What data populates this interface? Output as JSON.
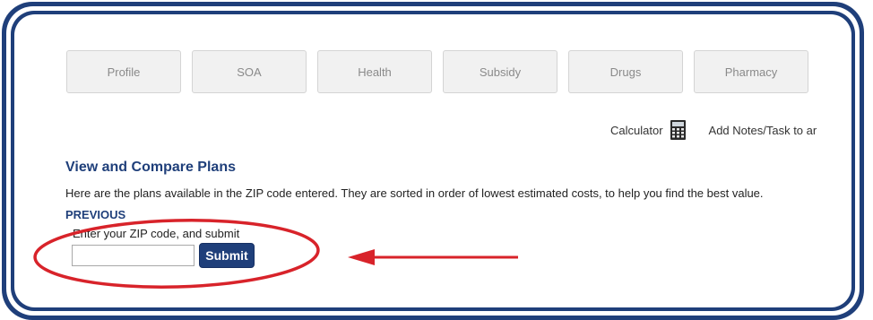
{
  "tabs": [
    {
      "label": "Profile"
    },
    {
      "label": "SOA"
    },
    {
      "label": "Health"
    },
    {
      "label": "Subsidy"
    },
    {
      "label": "Drugs"
    },
    {
      "label": "Pharmacy"
    }
  ],
  "tools": {
    "calculator_label": "Calculator",
    "calculator_icon": "calculator-icon",
    "notes_label": "Add Notes/Task to ar"
  },
  "main": {
    "title": "View and Compare Plans",
    "intro": "Here are the plans available in the ZIP code entered. They are sorted in order of lowest estimated costs, to help you find the best value.",
    "previous_label": "PREVIOUS",
    "zip_prompt": "Enter your ZIP code, and submit",
    "zip_value": "",
    "submit_label": "Submit"
  },
  "annotation": {
    "highlight_color": "#d8232a",
    "arrow_color": "#d8232a"
  },
  "colors": {
    "brand": "#1f3f7a",
    "tab_bg": "#f1f1f1",
    "tab_text": "#8a8a8a"
  }
}
